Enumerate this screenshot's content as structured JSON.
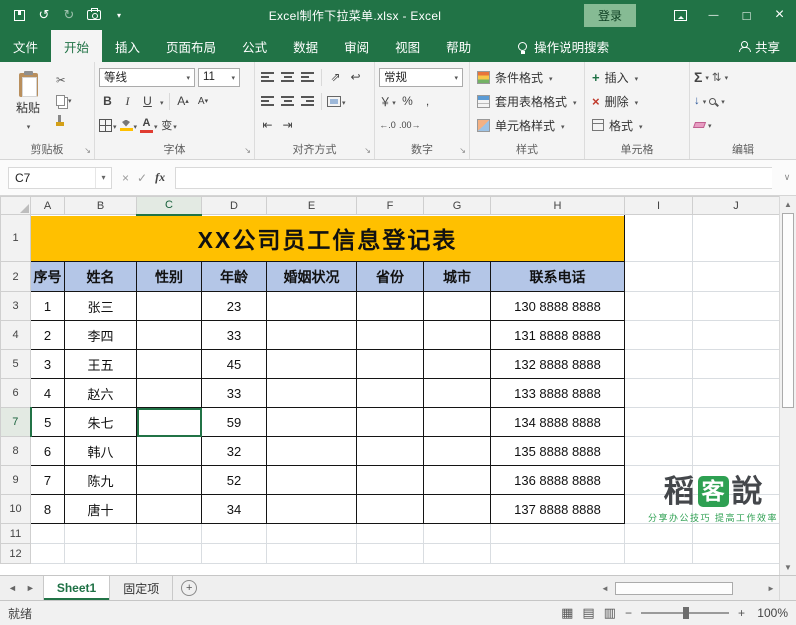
{
  "colors": {
    "excel_green": "#217346",
    "title_row_fill": "#FFC000",
    "header_row_fill": "#B4C6E7",
    "table_border": "#141414"
  },
  "title_bar": {
    "document_title": "Excel制作下拉菜单.xlsx  -  Excel",
    "login_label": "登录"
  },
  "ribbon": {
    "tabs": [
      "文件",
      "开始",
      "插入",
      "页面布局",
      "公式",
      "数据",
      "审阅",
      "视图",
      "帮助"
    ],
    "active_tab": "开始",
    "tell_me_label": "操作说明搜索",
    "share_label": "共享",
    "clipboard": {
      "paste_label": "粘贴",
      "group_label": "剪贴板"
    },
    "font": {
      "font_name": "等线",
      "font_size": "11",
      "group_label": "字体"
    },
    "alignment": {
      "group_label": "对齐方式"
    },
    "number": {
      "format_value": "常规",
      "group_label": "数字"
    },
    "styles": {
      "conditional_label": "条件格式",
      "table_format_label": "套用表格格式",
      "cell_styles_label": "单元格样式",
      "group_label": "样式"
    },
    "cells": {
      "insert_label": "插入",
      "delete_label": "删除",
      "format_label": "格式",
      "group_label": "单元格"
    },
    "editing": {
      "group_label": "编辑"
    }
  },
  "glyphs": {
    "undo": "↺",
    "redo": "↻",
    "cut": "✂",
    "bold": "B",
    "italic": "I",
    "underline": "U",
    "grow_font": "A",
    "shrink_font": "A",
    "font_color": "A",
    "phonetic": "变",
    "orientation": "⇗",
    "wrap": "↩",
    "indent_left": "⇤",
    "indent_right": "⇥",
    "currency": "￥",
    "percent": "%",
    "comma": ",",
    "inc_decimal": "←.0",
    "dec_decimal": ".00→",
    "autosum": "Σ",
    "fill_down": "↓",
    "sort": "⇅",
    "fx": "fx",
    "cancel": "×",
    "enter": "✓",
    "normal_view": "▦",
    "page_layout_view": "▤",
    "page_break_view": "▥"
  },
  "formula_bar": {
    "name_box": "C7",
    "formula_value": ""
  },
  "sheet": {
    "col_headers": [
      "A",
      "B",
      "C",
      "D",
      "E",
      "F",
      "G",
      "H",
      "I",
      "J"
    ],
    "selected_cell": "C7",
    "selected_col": "C",
    "selected_row": "7",
    "title": "XX公司员工信息登记表",
    "table_headers": [
      "序号",
      "姓名",
      "性别",
      "年龄",
      "婚姻状况",
      "省份",
      "城市",
      "联系电话"
    ],
    "rows": [
      [
        "1",
        "张三",
        "",
        "23",
        "",
        "",
        "",
        "130 8888 8888"
      ],
      [
        "2",
        "李四",
        "",
        "33",
        "",
        "",
        "",
        "131 8888 8888"
      ],
      [
        "3",
        "王五",
        "",
        "45",
        "",
        "",
        "",
        "132 8888 8888"
      ],
      [
        "4",
        "赵六",
        "",
        "33",
        "",
        "",
        "",
        "133 8888 8888"
      ],
      [
        "5",
        "朱七",
        "",
        "59",
        "",
        "",
        "",
        "134 8888 8888"
      ],
      [
        "6",
        "韩八",
        "",
        "32",
        "",
        "",
        "",
        "135 8888 8888"
      ],
      [
        "7",
        "陈九",
        "",
        "52",
        "",
        "",
        "",
        "136 8888 8888"
      ],
      [
        "8",
        "唐十",
        "",
        "34",
        "",
        "",
        "",
        "137 8888 8888"
      ]
    ],
    "extra_row_numbers": [
      "11",
      "12"
    ]
  },
  "sheet_tabs": {
    "tabs": [
      "Sheet1",
      "固定项"
    ],
    "active": "Sheet1"
  },
  "status_bar": {
    "status": "就绪",
    "zoom": "100%"
  },
  "watermark": {
    "char1": "稻",
    "char2": "客",
    "char3": "說",
    "tagline": "分享办公技巧 提高工作效率"
  }
}
